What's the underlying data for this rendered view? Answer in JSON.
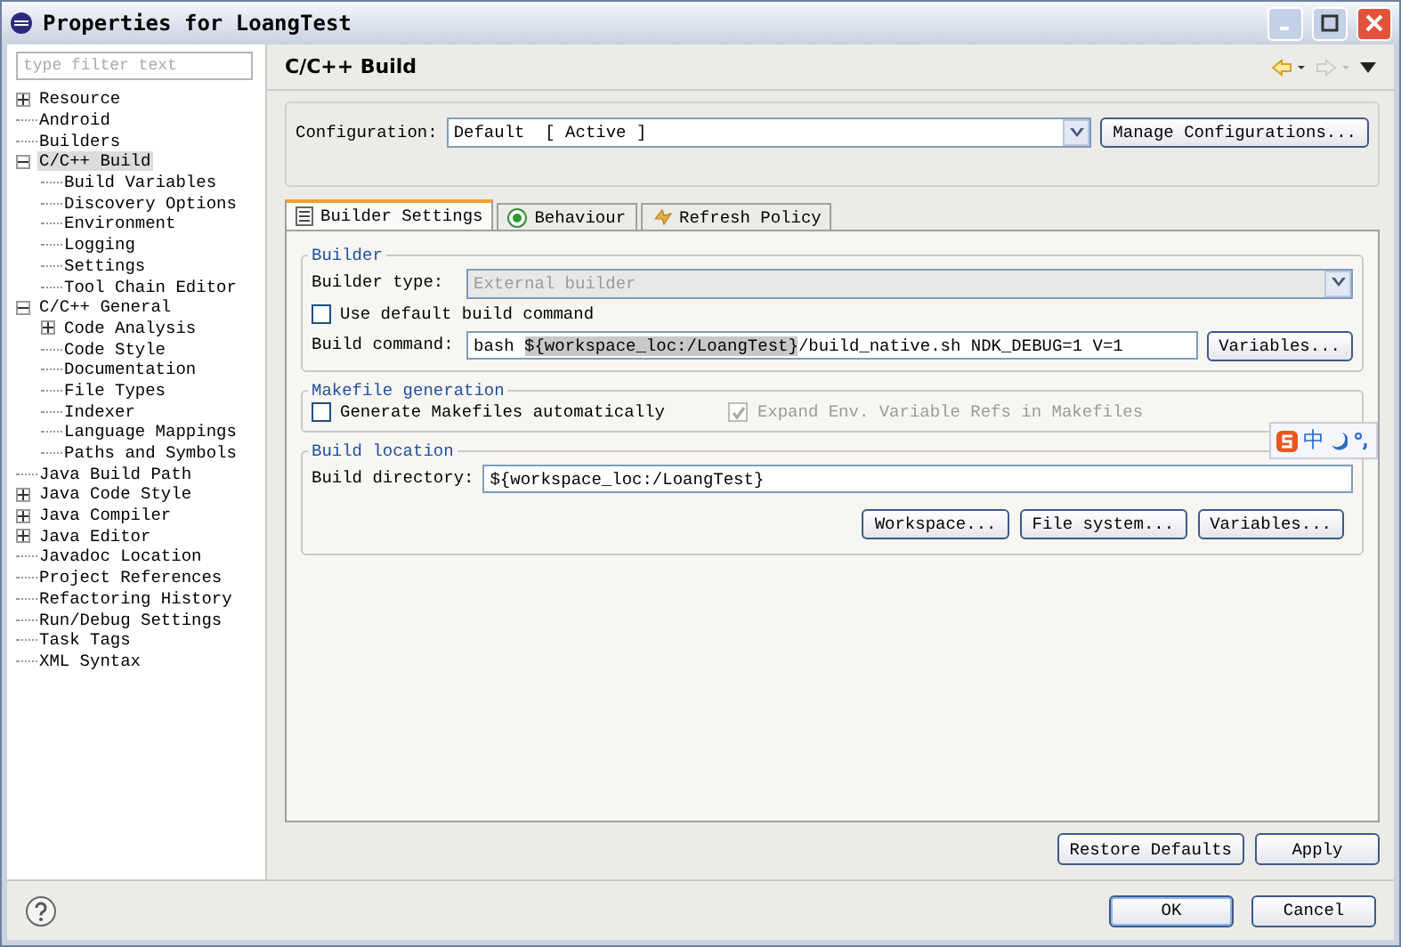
{
  "window": {
    "title": "Properties for LoangTest"
  },
  "filter": {
    "placeholder": "type filter text"
  },
  "tree": [
    {
      "label": "Resource",
      "expanded": false,
      "selected": false
    },
    {
      "label": "Android",
      "selected": false
    },
    {
      "label": "Builders",
      "selected": false
    },
    {
      "label": "C/C++ Build",
      "expanded": true,
      "selected": true,
      "children": [
        {
          "label": "Build Variables",
          "selected": false
        },
        {
          "label": "Discovery Options",
          "selected": false
        },
        {
          "label": "Environment",
          "selected": false
        },
        {
          "label": "Logging",
          "selected": false
        },
        {
          "label": "Settings",
          "selected": false
        },
        {
          "label": "Tool Chain Editor",
          "selected": false
        }
      ]
    },
    {
      "label": "C/C++ General",
      "expanded": true,
      "selected": false,
      "children": [
        {
          "label": "Code Analysis",
          "expanded": false,
          "selected": false
        },
        {
          "label": "Code Style",
          "selected": false
        },
        {
          "label": "Documentation",
          "selected": false
        },
        {
          "label": "File Types",
          "selected": false
        },
        {
          "label": "Indexer",
          "selected": false
        },
        {
          "label": "Language Mappings",
          "selected": false
        },
        {
          "label": "Paths and Symbols",
          "selected": false
        }
      ]
    },
    {
      "label": "Java Build Path",
      "selected": false
    },
    {
      "label": "Java Code Style",
      "expanded": false,
      "selected": false
    },
    {
      "label": "Java Compiler",
      "expanded": false,
      "selected": false
    },
    {
      "label": "Java Editor",
      "expanded": false,
      "selected": false
    },
    {
      "label": "Javadoc Location",
      "selected": false
    },
    {
      "label": "Project References",
      "selected": false
    },
    {
      "label": "Refactoring History",
      "selected": false
    },
    {
      "label": "Run/Debug Settings",
      "selected": false
    },
    {
      "label": "Task Tags",
      "selected": false
    },
    {
      "label": "XML Syntax",
      "selected": false
    }
  ],
  "page": {
    "title": "C/C++ Build"
  },
  "configuration": {
    "label": "Configuration:",
    "value": "Default  [ Active ]",
    "button": "Manage Configurations..."
  },
  "tabs": [
    {
      "label": "Builder Settings",
      "kind": "list",
      "selected": true
    },
    {
      "label": "Behaviour",
      "kind": "radio",
      "selected": false
    },
    {
      "label": "Refresh Policy",
      "kind": "refresh",
      "selected": false
    }
  ],
  "builder": {
    "title": "Builder",
    "type_label": "Builder type:",
    "type_value": "External builder",
    "type_disabled": true,
    "default_cmd": {
      "label": "Use default build command",
      "checked": false
    },
    "cmd_label": "Build command:",
    "cmd_parts": [
      "bash ",
      "${workspace_loc:/LoangTest}",
      "/build_native.sh NDK_DEBUG=1 V=1"
    ],
    "cmd_button": "Variables..."
  },
  "makefile": {
    "title": "Makefile generation",
    "generate": {
      "label": "Generate Makefiles automatically",
      "checked": false,
      "disabled": false
    },
    "expand": {
      "label": "Expand Env. Variable Refs in Makefiles",
      "checked": true,
      "disabled": true
    }
  },
  "location": {
    "title": "Build location",
    "dir_label": "Build directory:",
    "dir_value": "${workspace_loc:/LoangTest}",
    "buttons": [
      "Workspace...",
      "File system...",
      "Variables..."
    ]
  },
  "ime_bar": {
    "mode": "中"
  },
  "page_buttons": [
    "Restore Defaults",
    "Apply"
  ],
  "dialog_buttons": [
    {
      "label": "OK",
      "default": true
    },
    {
      "label": "Cancel",
      "default": false
    }
  ]
}
